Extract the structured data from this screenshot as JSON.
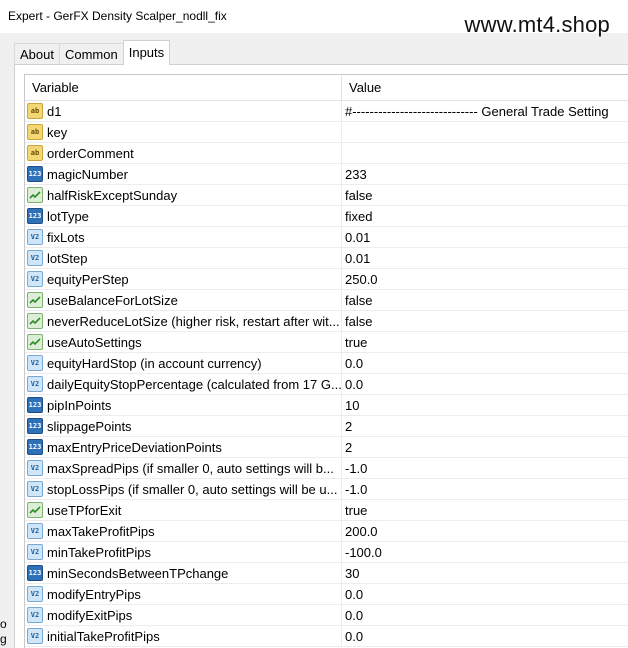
{
  "window": {
    "title": "Expert - GerFX Density Scalper_nodll_fix",
    "watermark": "www.mt4.shop"
  },
  "tabs": [
    {
      "label": "About",
      "active": false
    },
    {
      "label": "Common",
      "active": false
    },
    {
      "label": "Inputs",
      "active": true
    }
  ],
  "grid": {
    "headers": {
      "variable": "Variable",
      "value": "Value"
    },
    "rows": [
      {
        "icon": "string-icon",
        "type": "ab",
        "name": "d1",
        "value": "#----------------------------- General Trade Setting"
      },
      {
        "icon": "string-icon",
        "type": "ab",
        "name": "key",
        "value": ""
      },
      {
        "icon": "string-icon",
        "type": "ab",
        "name": "orderComment",
        "value": ""
      },
      {
        "icon": "integer-icon",
        "type": "n123",
        "name": "magicNumber",
        "value": "233"
      },
      {
        "icon": "boolean-icon",
        "type": "bool",
        "name": "halfRiskExceptSunday",
        "value": "false"
      },
      {
        "icon": "integer-icon",
        "type": "n123",
        "name": "lotType",
        "value": "fixed"
      },
      {
        "icon": "double-icon",
        "type": "va",
        "name": "fixLots",
        "value": "0.01"
      },
      {
        "icon": "double-icon",
        "type": "va",
        "name": "lotStep",
        "value": "0.01"
      },
      {
        "icon": "double-icon",
        "type": "va",
        "name": "equityPerStep",
        "value": "250.0"
      },
      {
        "icon": "boolean-icon",
        "type": "bool",
        "name": "useBalanceForLotSize",
        "value": "false"
      },
      {
        "icon": "boolean-icon",
        "type": "bool",
        "name": "neverReduceLotSize (higher risk, restart after wit...",
        "value": "false"
      },
      {
        "icon": "boolean-icon",
        "type": "bool",
        "name": "useAutoSettings",
        "value": "true"
      },
      {
        "icon": "double-icon",
        "type": "va",
        "name": "equityHardStop (in account currency)",
        "value": "0.0"
      },
      {
        "icon": "double-icon",
        "type": "va",
        "name": "dailyEquityStopPercentage (calculated from 17 G...",
        "value": "0.0"
      },
      {
        "icon": "integer-icon",
        "type": "n123",
        "name": "pipInPoints",
        "value": "10"
      },
      {
        "icon": "integer-icon",
        "type": "n123",
        "name": "slippagePoints",
        "value": "2"
      },
      {
        "icon": "integer-icon",
        "type": "n123",
        "name": "maxEntryPriceDeviationPoints",
        "value": "2"
      },
      {
        "icon": "double-icon",
        "type": "va",
        "name": "maxSpreadPips (if smaller 0, auto settings will b...",
        "value": "-1.0"
      },
      {
        "icon": "double-icon",
        "type": "va",
        "name": "stopLossPips (if smaller 0, auto settings will be u...",
        "value": "-1.0"
      },
      {
        "icon": "boolean-icon",
        "type": "bool",
        "name": "useTPforExit",
        "value": "true"
      },
      {
        "icon": "double-icon",
        "type": "va",
        "name": "maxTakeProfitPips",
        "value": "200.0"
      },
      {
        "icon": "double-icon",
        "type": "va",
        "name": "minTakeProfitPips",
        "value": "-100.0"
      },
      {
        "icon": "integer-icon",
        "type": "n123",
        "name": "minSecondsBetweenTPchange",
        "value": "30"
      },
      {
        "icon": "double-icon",
        "type": "va",
        "name": "modifyEntryPips",
        "value": "0.0"
      },
      {
        "icon": "double-icon",
        "type": "va",
        "name": "modifyExitPips",
        "value": "0.0"
      },
      {
        "icon": "double-icon",
        "type": "va",
        "name": "initialTakeProfitPips",
        "value": "0.0"
      }
    ]
  },
  "edge_fragments": [
    "o",
    "g"
  ]
}
